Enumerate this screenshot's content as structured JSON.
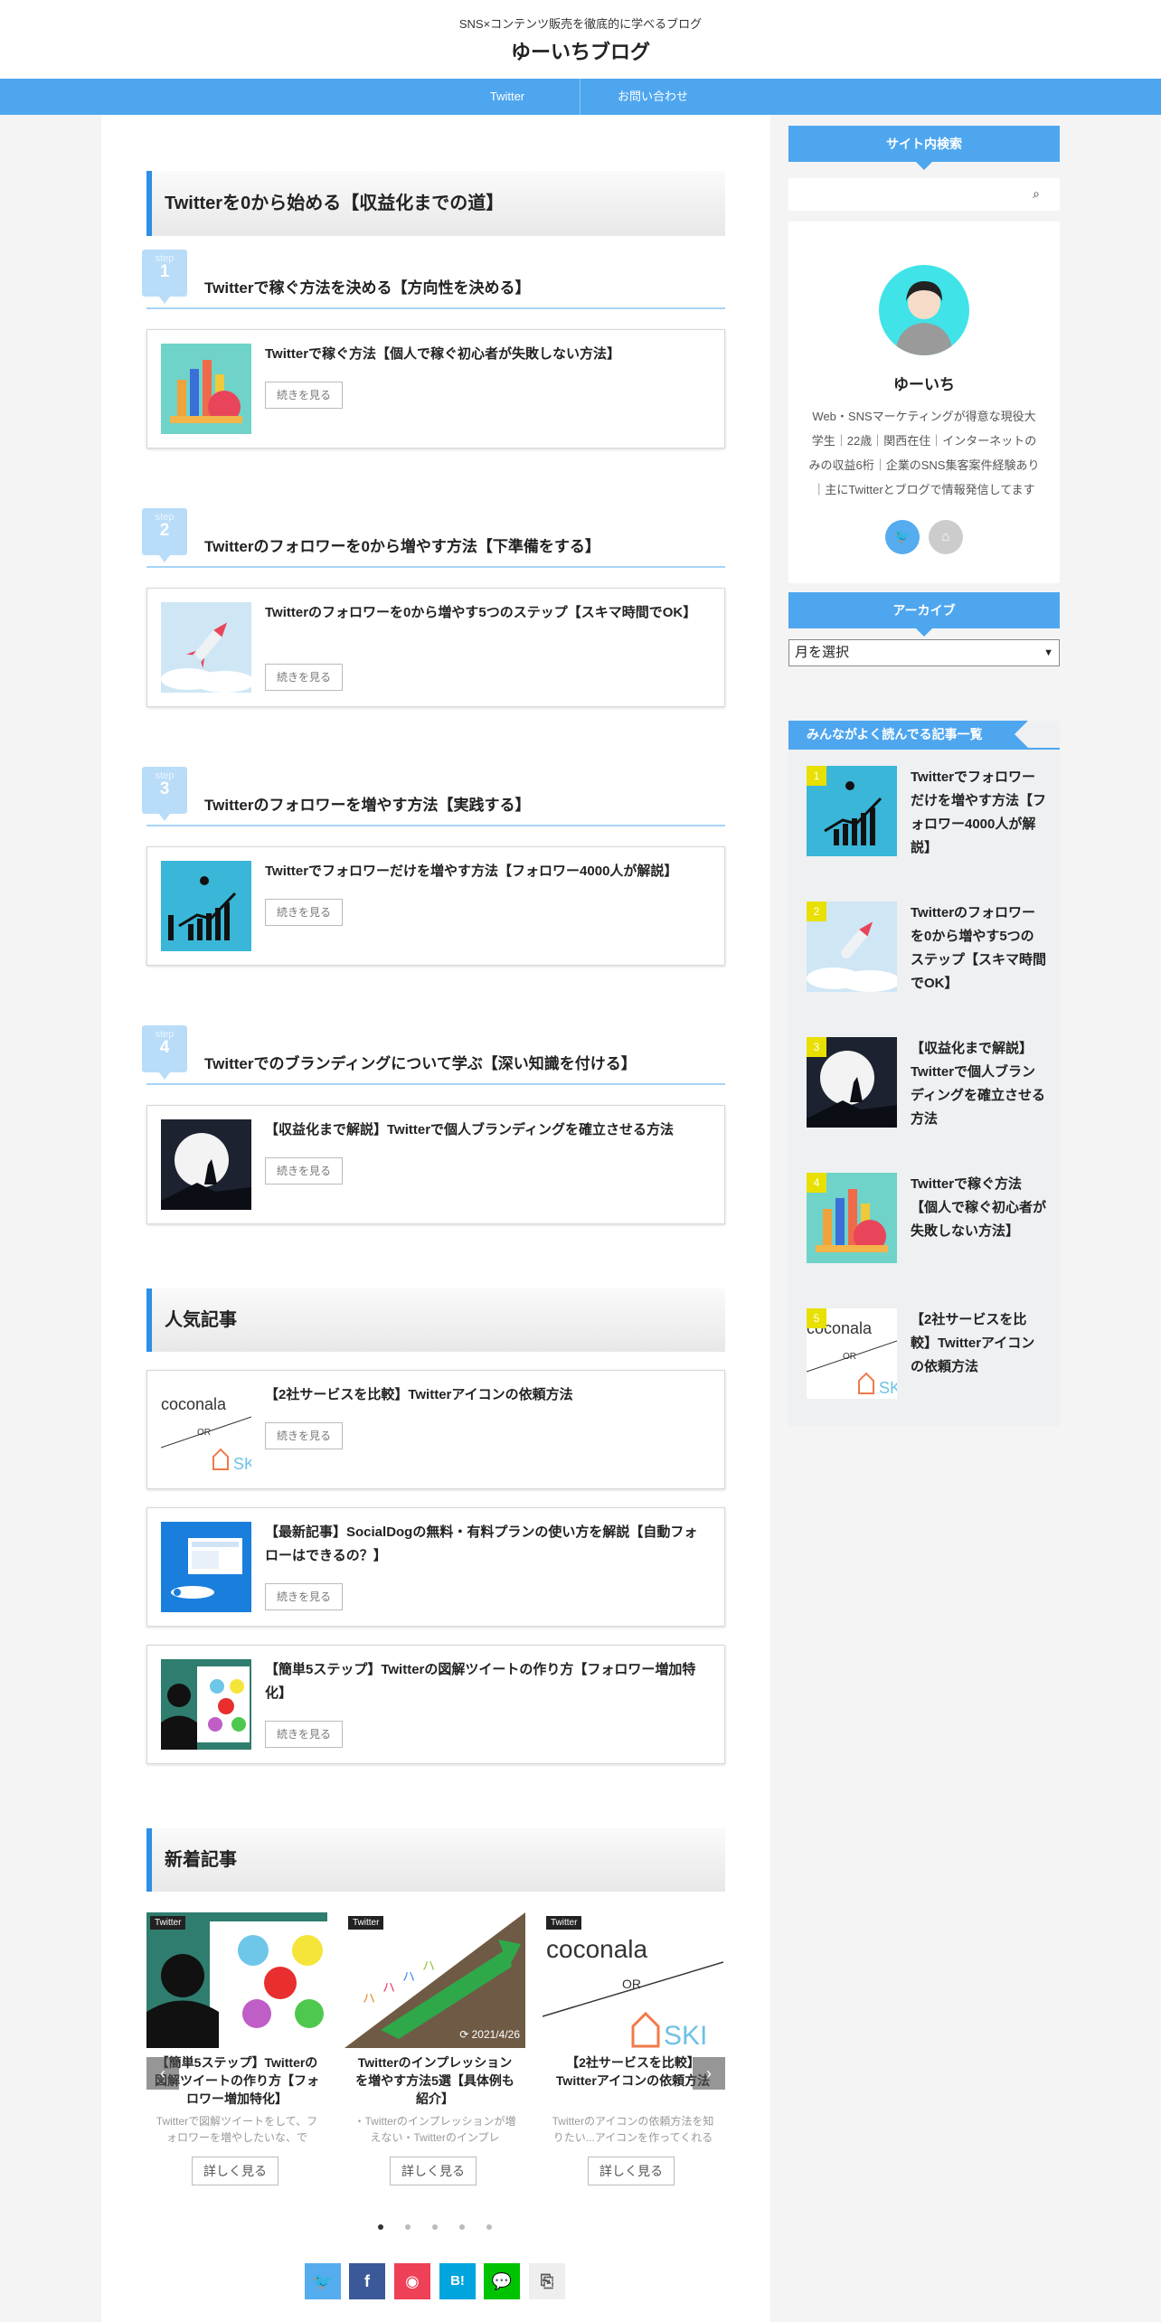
{
  "header": {
    "description": "SNS×コンテンツ販売を徹底的に学べるブログ",
    "title": "ゆーいちブログ"
  },
  "nav": [
    {
      "label": "Twitter"
    },
    {
      "label": "お問い合わせ"
    }
  ],
  "main": {
    "roadmap_heading": "Twitterを0から始める【収益化までの道】",
    "steps": [
      {
        "label": "step",
        "num": "1",
        "title": "Twitterで稼ぐ方法を決める【方向性を決める】",
        "article": "Twitterで稼ぐ方法【個人で稼ぐ初心者が失敗しない方法】"
      },
      {
        "label": "step",
        "num": "2",
        "title": "Twitterのフォロワーを0から増やす方法【下準備をする】",
        "article": "Twitterのフォロワーを0から増やす5つのステップ【スキマ時間でOK】"
      },
      {
        "label": "step",
        "num": "3",
        "title": "Twitterのフォロワーを増やす方法【実践する】",
        "article": "Twitterでフォロワーだけを増やす方法【フォロワー4000人が解説】"
      },
      {
        "label": "step",
        "num": "4",
        "title": "Twitterでのブランディングについて学ぶ【深い知識を付ける】",
        "article": "【収益化まで解説】Twitterで個人ブランディングを確立させる方法"
      }
    ],
    "more_label": "続きを見る",
    "popular_heading": "人気記事",
    "popular": [
      {
        "title": "【2社サービスを比較】Twitterアイコンの依頼方法"
      },
      {
        "title": "【最新記事】SocialDogの無料・有料プランの使い方を解説【自動フォローはできるの？】"
      },
      {
        "title": "【簡単5ステップ】Twitterの図解ツイートの作り方【フォロワー増加特化】"
      }
    ],
    "new_heading": "新着記事",
    "new_posts": [
      {
        "tag": "Twitter",
        "title": "【簡単5ステップ】Twitterの図解ツイートの作り方【フォロワー増加特化】",
        "excerpt": "Twitterで図解ツイートをして、フォロワーを増やしたいな、で",
        "date": ""
      },
      {
        "tag": "Twitter",
        "title": "Twitterのインプレッションを増やす方法5選【具体例も紹介】",
        "excerpt": "・Twitterのインプレッションが増えない・Twitterのインプレ",
        "date": "2021/4/26"
      },
      {
        "tag": "Twitter",
        "title": "【2社サービスを比較】Twitterアイコンの依頼方法",
        "excerpt": "Twitterのアイコンの依頼方法を知りたい...アイコンを作ってくれるサービスと納品までの流れ",
        "date": ""
      }
    ],
    "detail_label": "詳しく見る",
    "share": [
      "twitter",
      "facebook",
      "pocket",
      "hatena",
      "line",
      "copy"
    ]
  },
  "sidebar": {
    "search_heading": "サイト内検索",
    "search_placeholder": "",
    "profile_name": "ゆーいち",
    "profile_text": "Web・SNSマーケティングが得意な現役大学生｜22歳｜関西在住｜インターネットのみの収益6桁｜企業のSNS集客案件経験あり｜主にTwitterとブログで情報発信してます",
    "archive_heading": "アーカイブ",
    "archive_select": "月を選択",
    "ranking_heading": "みんながよく読んでる記事一覧",
    "ranking": [
      {
        "rank": "1",
        "title": "Twitterでフォロワーだけを増やす方法【フォロワー4000人が解説】"
      },
      {
        "rank": "2",
        "title": "Twitterのフォロワーを0から増やす5つのステップ【スキマ時間でOK】"
      },
      {
        "rank": "3",
        "title": "【収益化まで解説】Twitterで個人ブランディングを確立させる方法"
      },
      {
        "rank": "4",
        "title": "Twitterで稼ぐ方法【個人で稼ぐ初心者が失敗しない方法】"
      },
      {
        "rank": "5",
        "title": "【2社サービスを比較】Twitterアイコンの依頼方法"
      }
    ]
  },
  "colors": {
    "accent": "#4ea6ef",
    "accent_dark": "#2d8fe5"
  }
}
